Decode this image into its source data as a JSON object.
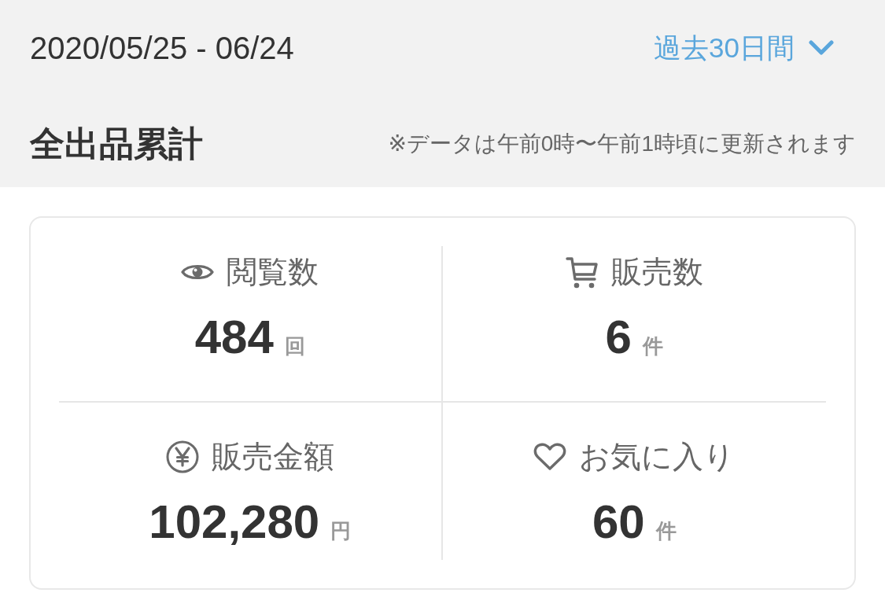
{
  "header": {
    "date_range": "2020/05/25 - 06/24",
    "period_dropdown": {
      "label": "過去30日間"
    }
  },
  "summary": {
    "title": "全出品累計",
    "note": "※データは午前0時〜午前1時頃に更新されます"
  },
  "stats": [
    {
      "kind": "views",
      "label": "閲覧数",
      "value": "484",
      "unit": "回"
    },
    {
      "kind": "sales",
      "label": "販売数",
      "value": "6",
      "unit": "件"
    },
    {
      "kind": "revenue",
      "label": "販売金額",
      "value": "102,280",
      "unit": "円"
    },
    {
      "kind": "favorites",
      "label": "お気に入り",
      "value": "60",
      "unit": "件"
    }
  ]
}
